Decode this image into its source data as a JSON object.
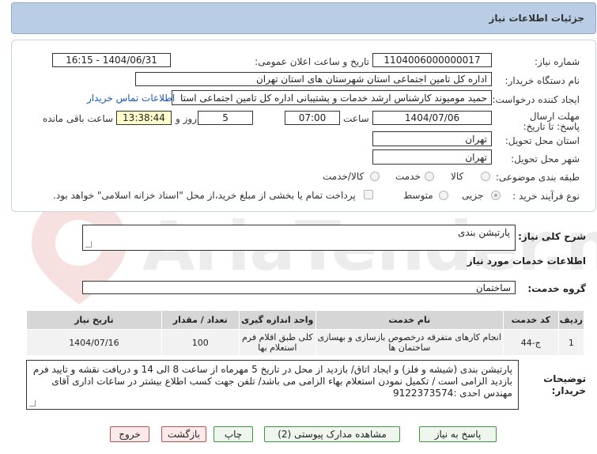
{
  "header": {
    "title": "جزئیات اطلاعات نیاز"
  },
  "form": {
    "need_number_label": "شماره نیاز:",
    "need_number": "1104006000000017",
    "announce_label": "تاریخ و ساعت اعلان عمومی:",
    "announce_value": "1404/06/31 - 16:15",
    "buyer_org_label": "نام دستگاه خریدار:",
    "buyer_org": "اداره کل تامین اجتماعی استان شهرستان های استان تهران",
    "creator_label": "ایجاد کننده درخواست:",
    "creator": "حمید مومیوند کارشناس ارشد خدمات و پشتیبانی اداره کل تامین اجتماعی استا",
    "contact_link": "اطلاعات تماس خریدار",
    "deadline_label": "مهلت ارسال پاسخ: تا تاریخ:",
    "deadline_date": "1404/07/06",
    "time_label": "ساعت",
    "deadline_time": "07:00",
    "days_value": "5",
    "days_label": "روز و",
    "remaining_time": "13:38:44",
    "remaining_label": "ساعت باقی مانده",
    "province_label": "استان محل تحویل:",
    "province": "تهران",
    "city_label": "شهر محل تحویل:",
    "city": "تهران",
    "category_label": "طبقه بندی موضوعی:",
    "category_options": [
      "کالا",
      "خدمت",
      "کالا/خدمت"
    ],
    "purchase_type_label": "نوع فرآیند خرید :",
    "purchase_options": [
      "جزیی",
      "متوسط"
    ],
    "payment_note": "پرداخت تمام یا بخشی از مبلغ خرید،از محل \"اسناد خزانه اسلامی\" خواهد بود."
  },
  "general_desc": {
    "label": "شرح کلی نیاز:",
    "value": "پارتیشن بندی"
  },
  "services_section": {
    "title": "اطلاعات خدمات مورد نیاز"
  },
  "service_group": {
    "label": "گروه خدمت:",
    "value": "ساختمان"
  },
  "table": {
    "headers": [
      "ردیف",
      "کد خدمت",
      "نام خدمت",
      "واحد اندازه گیری",
      "تعداد / مقدار",
      "تاریخ نیاز"
    ],
    "rows": [
      [
        "1",
        "ج-44",
        "انجام کارهای متفرقه درخصوص بازسازی و بهسازی ساختمان ها",
        "کلی طبق اقلام فرم استعلام بها",
        "100",
        "1404/07/16"
      ]
    ]
  },
  "buyer_notes": {
    "label": "توضیحات خریدار:",
    "text": "پارتیشن بندی (شیشه و فلز) و ایجاد اتاق/ بازدید از محل در تاریخ 5 مهرماه از ساعت 8 الی 14 و دریافت نقشه و تایید فرم بازدید الزامی است / تکمیل نمودن استعلام بهاء الزامی می باشد/ تلفن جهت کسب اطلاع بیشتر در ساعات اداری آقای مهندس احدی :9122373574"
  },
  "buttons": {
    "reply": "پاسخ به نیاز",
    "attachments": "مشاهده مدارک پیوستی (2)",
    "print": "چاپ",
    "back": "بازگشت",
    "exit": "خروج"
  },
  "watermark": "AriaTender.neT",
  "colors": {
    "header_bg": "#b9cde6",
    "link": "#1a56b8",
    "highlight": "#ffffcc"
  }
}
